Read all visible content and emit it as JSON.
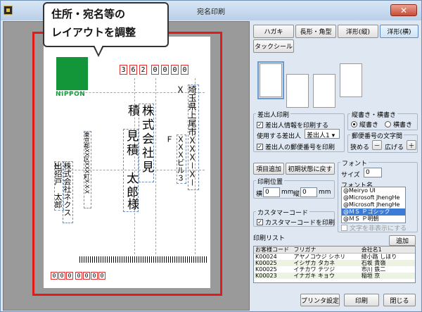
{
  "window": {
    "title": "宛名印刷",
    "close_label": "✕"
  },
  "callout": {
    "line1": "住所・宛名等の",
    "line2": "レイアウトを調整"
  },
  "preview": {
    "logo_text": "NIPPON",
    "zip_digits": [
      "3",
      "6",
      "2",
      "0",
      "0",
      "0",
      "0"
    ],
    "recipient_address": "埼玉県上尾市ＸＸＸ－Ｘ－Ｘ",
    "recipient_building": "ＸＸＸビル３Ｆ",
    "recipient_company": "株式会社見積",
    "recipient_name": "見積　太郎",
    "recipient_honorific": "様",
    "sender_company": "株式会社ネクスト",
    "sender_name": "出招戸　太郎",
    "sender_address": "東京都XX区XXX町X-X-X",
    "sender_zip": [
      "0",
      "0",
      "0",
      "0",
      "0",
      "0",
      "0"
    ]
  },
  "format_buttons": [
    "ハガキ",
    "長形・角型",
    "洋形(縦)",
    "洋形(横)",
    "タックシール"
  ],
  "sender_print": {
    "title": "差出人印刷",
    "print_info": "差出人情報を印刷する",
    "sender_label": "使用する差出人",
    "sender_value": "差出人1",
    "print_zip": "差出人の郵便番号を印刷"
  },
  "orientation": {
    "title": "縦書き・横書き",
    "vertical": "縦書き",
    "horizontal": "横書き"
  },
  "zip_spacing": {
    "title": "郵便番号の文字間",
    "narrow": "狭める",
    "narrow_btn": "－",
    "wide": "広げる",
    "wide_btn": "＋"
  },
  "buttons": {
    "add_item": "項目追加",
    "reset": "初期状態に戻す",
    "add": "追加",
    "printer": "プリンタ設定",
    "print": "印刷",
    "close": "閉じる"
  },
  "print_position": {
    "title": "印刷位置",
    "h_label": "横",
    "h_value": "0",
    "v_label": "縦",
    "v_value": "0",
    "unit": "mm"
  },
  "font": {
    "title": "フォント",
    "size_label": "サイズ",
    "size_value": "0",
    "name_label": "フォント名",
    "items": [
      "@Meiryo UI",
      "@Microsoft JhengHe",
      "@Microsoft JhengHe",
      "@ＭＳ Ｐゴシック",
      "@ＭＳ Ｐ明朝"
    ],
    "selected_index": 3,
    "hide_label": "文字を非表示にする"
  },
  "customer_code": {
    "title": "カスタマーコード",
    "print_label": "カスタマーコードを印刷"
  },
  "print_list": {
    "title": "印刷リスト",
    "columns": [
      "お客様コード",
      "フリガナ",
      "会社名1"
    ],
    "rows": [
      [
        "K00024",
        "アヤノコウジ シホリ",
        "綾小路 しほり"
      ],
      [
        "K00025",
        "イシザカ タカネ",
        "石坂 貴嶺"
      ],
      [
        "K00025",
        "イチカワ テツジ",
        "市川 鉄二"
      ],
      [
        "K00023",
        "イナガキ キョウ",
        "稲垣 京"
      ]
    ]
  },
  "colors": {
    "accent": "#13963a",
    "frame": "#e11b1b"
  }
}
